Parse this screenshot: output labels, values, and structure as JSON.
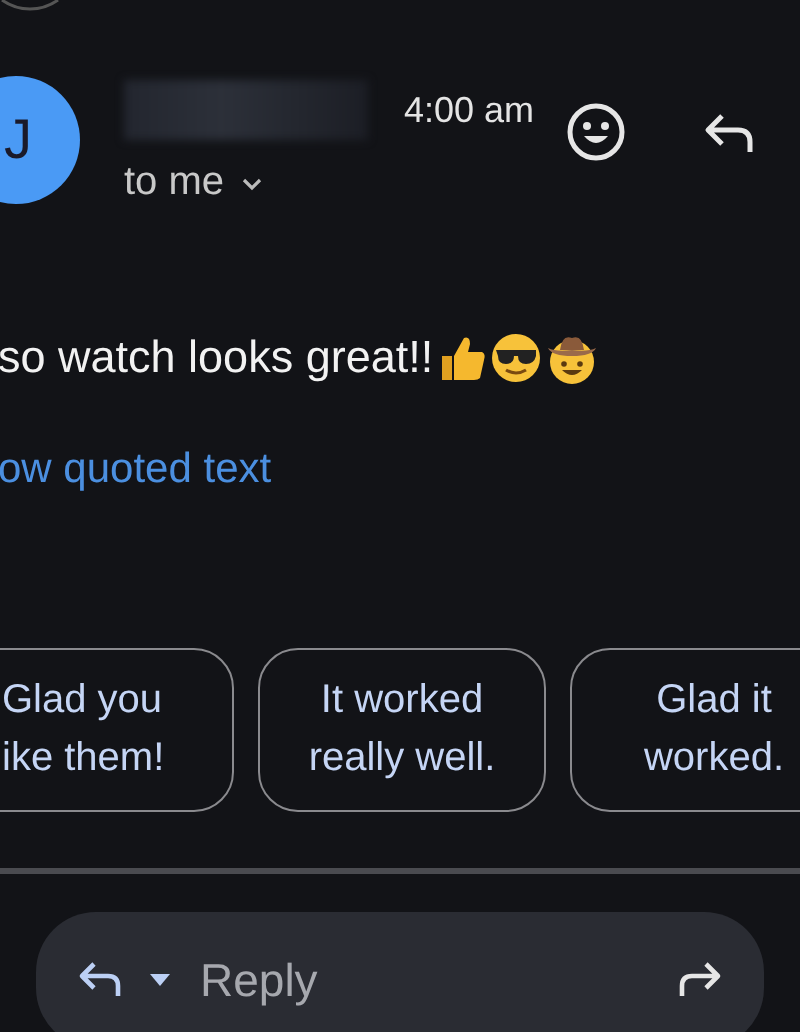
{
  "message": {
    "avatar_initial": "J",
    "time": "4:00 am",
    "recipient": "to me",
    "body": "so watch looks great!!",
    "quoted_link": "ow quoted text"
  },
  "smart_replies": [
    {
      "label": "Glad you\nike them!"
    },
    {
      "label": "It worked\nreally well."
    },
    {
      "label": "Glad it\nworked."
    }
  ],
  "reply_bar": {
    "placeholder": "Reply"
  }
}
